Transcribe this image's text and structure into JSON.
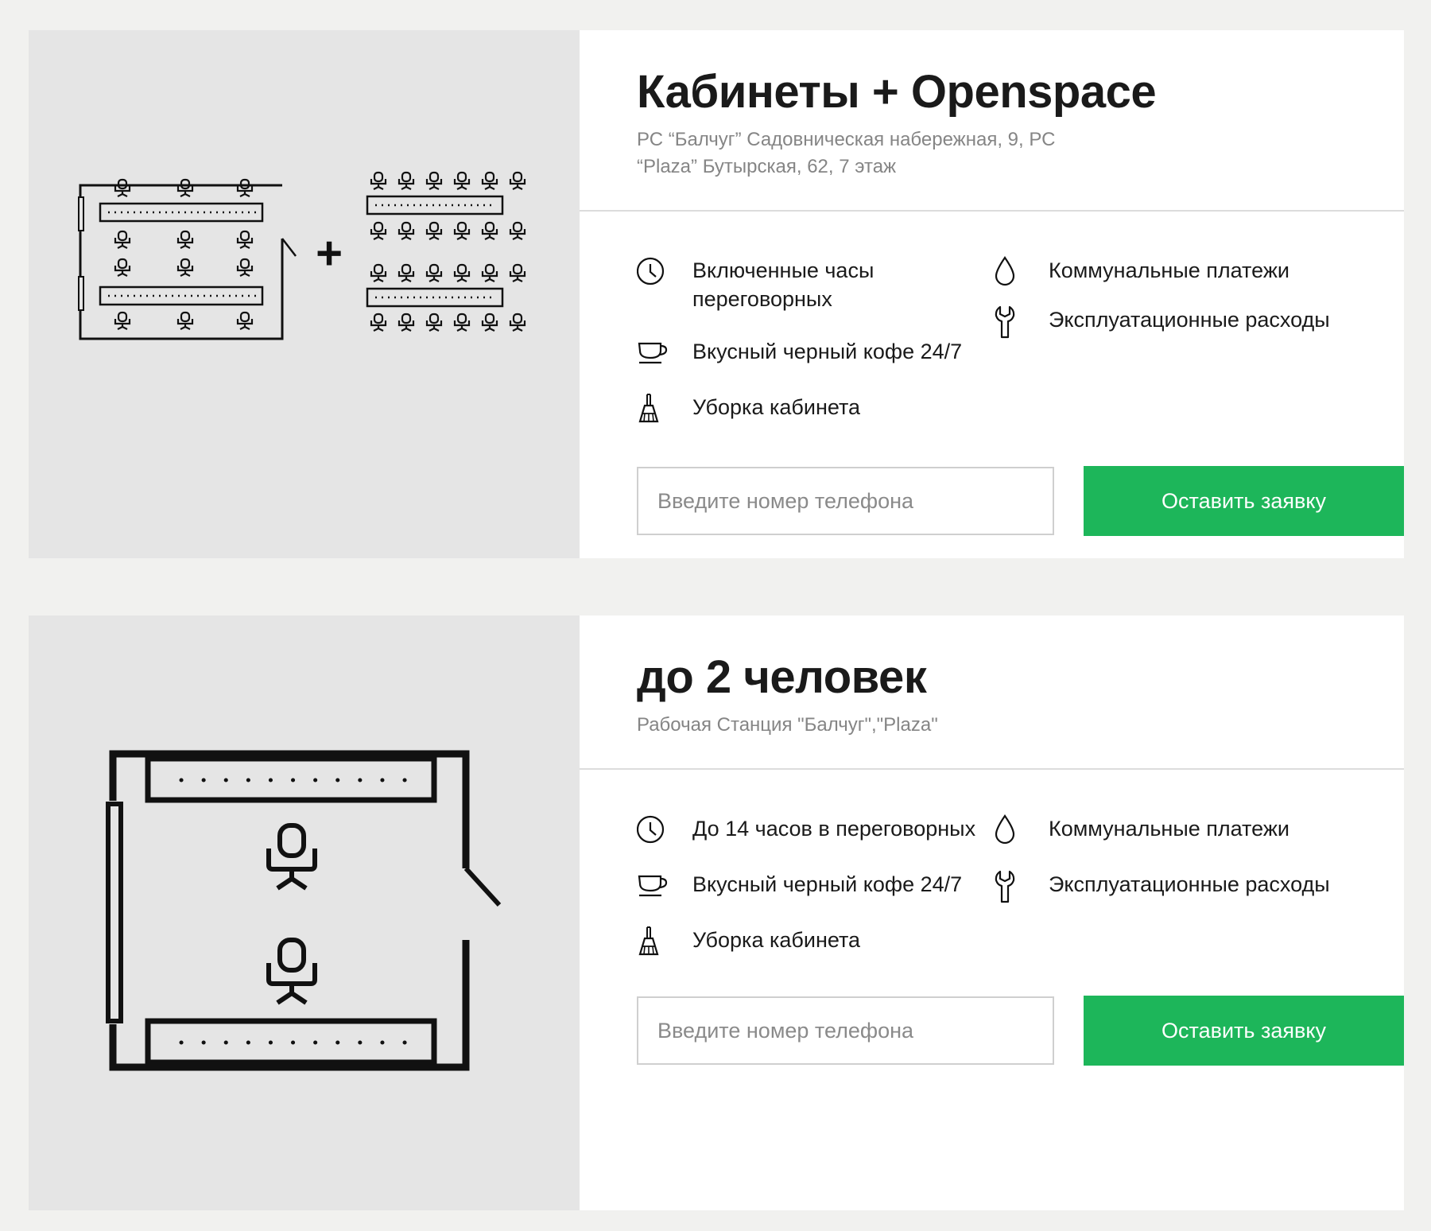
{
  "offers": [
    {
      "title": "Кабинеты + Openspace",
      "address": "РС “Балчуг” Садовническая набережная, 9, РС “Plaza” Бутырская, 62, 7 этаж",
      "features_left": [
        {
          "icon": "clock-icon",
          "label": "Включенные часы переговорных"
        },
        {
          "icon": "coffee-cup-icon",
          "label": "Вкусный черный кофе 24/7"
        },
        {
          "icon": "broom-icon",
          "label": "Уборка кабинета"
        }
      ],
      "features_right": [
        {
          "icon": "water-drop-icon",
          "label": "Коммунальные платежи"
        },
        {
          "icon": "wrench-icon",
          "label": "Эксплуатационные расходы"
        }
      ],
      "phone_placeholder": "Введите номер телефона",
      "submit_label": "Оставить заявку",
      "plan_plus": "+"
    },
    {
      "title": "до 2 человек",
      "address": "Рабочая Станция \"Балчуг\",\"Plaza\"",
      "features_left": [
        {
          "icon": "clock-icon",
          "label": "До 14 часов в переговорных"
        },
        {
          "icon": "coffee-cup-icon",
          "label": "Вкусный черный кофе 24/7"
        },
        {
          "icon": "broom-icon",
          "label": "Уборка кабинета"
        }
      ],
      "features_right": [
        {
          "icon": "water-drop-icon",
          "label": "Коммунальные платежи"
        },
        {
          "icon": "wrench-icon",
          "label": "Эксплуатационные расходы"
        }
      ],
      "phone_placeholder": "Введите номер телефона",
      "submit_label": "Оставить заявку"
    }
  ],
  "colors": {
    "page_background": "#f1f1ef",
    "plan_background": "#e5e5e5",
    "button": "#1db65a",
    "button_text": "#ffffff",
    "subtitle": "#858585"
  }
}
